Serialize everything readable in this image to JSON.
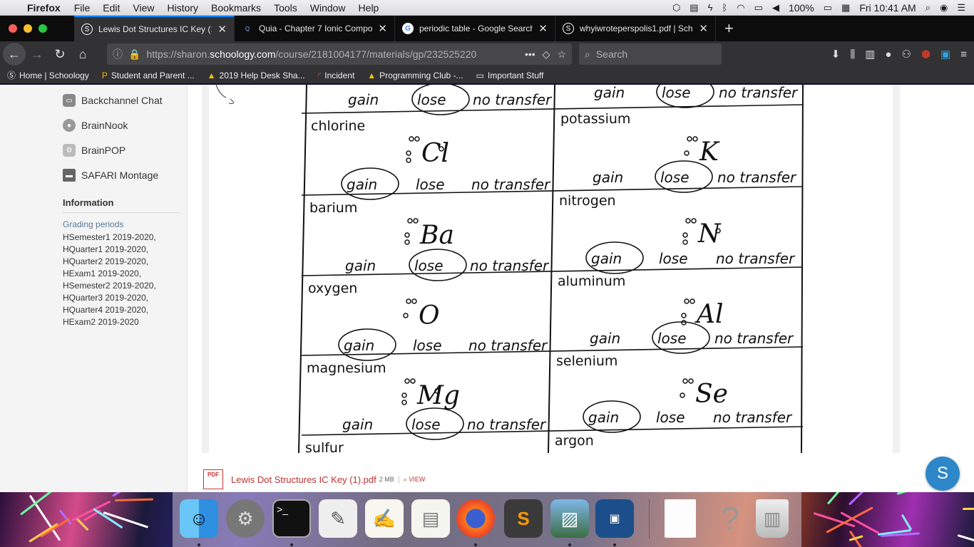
{
  "menubar": {
    "app": "Firefox",
    "items": [
      "File",
      "Edit",
      "View",
      "History",
      "Bookmarks",
      "Tools",
      "Window",
      "Help"
    ],
    "battery": "100%",
    "clock": "Fri 10:41 AM"
  },
  "tabs": [
    {
      "label": "Lewis Dot Structures IC Key (1).",
      "icon": "schoology-icon",
      "active": true
    },
    {
      "label": "Quia - Chapter 7 Ionic Compour",
      "icon": "quia-icon",
      "active": false
    },
    {
      "label": "periodic table - Google Search",
      "icon": "google-icon",
      "active": false
    },
    {
      "label": "whyiwroteperspolis1.pdf | Scho",
      "icon": "schoology-icon",
      "active": false
    }
  ],
  "nav": {
    "url_prefix": "https://sharon.",
    "url_domain": "schoology.com",
    "url_path": "/course/2181004177/materials/gp/232525220",
    "search_placeholder": "Search"
  },
  "bookmarks": [
    "Home | Schoology",
    "Student and Parent ...",
    "2019 Help Desk Sha...",
    "Incident",
    "Programming Club -...",
    "Important Stuff"
  ],
  "sidebar": {
    "items": [
      "Backchannel Chat",
      "BrainNook",
      "BrainPOP",
      "SAFARI Montage"
    ],
    "info_heading": "Information",
    "grading_label": "Grading periods",
    "grading_periods": [
      "HSemester1 2019-2020,",
      "HQuarter1 2019-2020,",
      "HQuarter2 2019-2020,",
      "HExam1 2019-2020,",
      "HSemester2 2019-2020,",
      "HQuarter3 2019-2020,",
      "HQuarter4 2019-2020,",
      "HExam2 2019-2020"
    ]
  },
  "worksheet": {
    "choices": {
      "gain": "gain",
      "lose": "lose",
      "none": "no transfer"
    },
    "cells": [
      {
        "element": "",
        "symbol": "",
        "circled": "lose"
      },
      {
        "element": "",
        "symbol": "",
        "circled": "lose"
      },
      {
        "element": "chlorine",
        "symbol": "Cl",
        "circled": "gain"
      },
      {
        "element": "potassium",
        "symbol": "K",
        "circled": "lose"
      },
      {
        "element": "barium",
        "symbol": "Ba",
        "circled": "lose"
      },
      {
        "element": "nitrogen",
        "symbol": "N",
        "circled": "gain"
      },
      {
        "element": "oxygen",
        "symbol": "O",
        "circled": "gain"
      },
      {
        "element": "aluminum",
        "symbol": "Al",
        "circled": "lose"
      },
      {
        "element": "magnesium",
        "symbol": "Mg",
        "circled": "lose"
      },
      {
        "element": "selenium",
        "symbol": "Se",
        "circled": "gain"
      },
      {
        "element": "sulfur",
        "symbol": "",
        "circled": ""
      },
      {
        "element": "argon",
        "symbol": "",
        "circled": ""
      }
    ]
  },
  "attachment": {
    "name": "Lewis Dot Structures IC Key (1).pdf",
    "size": "2 MB",
    "view": "VIEW",
    "badge": "PDF"
  },
  "help_button": "S"
}
